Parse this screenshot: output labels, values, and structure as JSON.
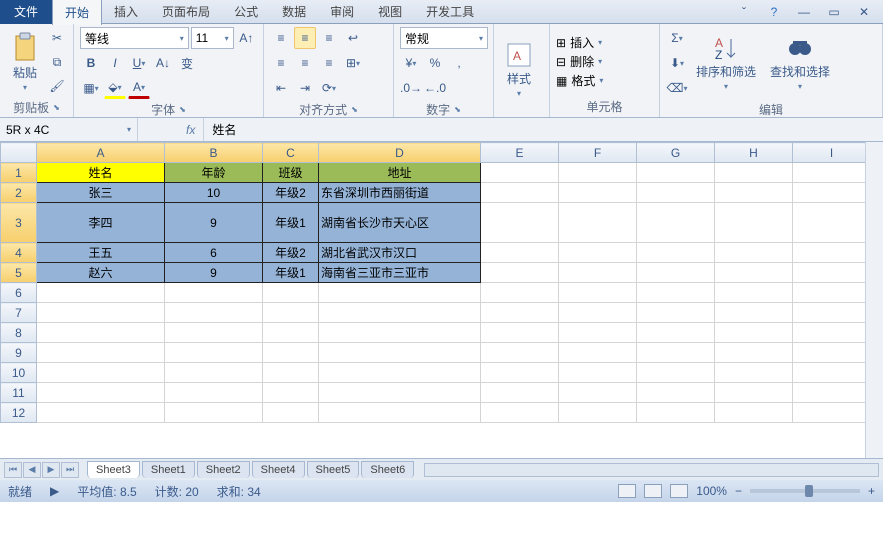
{
  "titlebar": {
    "file": "文件",
    "tabs": [
      "开始",
      "插入",
      "页面布局",
      "公式",
      "数据",
      "审阅",
      "视图",
      "开发工具"
    ],
    "active": 0
  },
  "ribbon": {
    "clipboard": {
      "label": "剪贴板",
      "paste": "粘贴"
    },
    "font": {
      "label": "字体",
      "name": "等线",
      "size": "11"
    },
    "align": {
      "label": "对齐方式"
    },
    "number": {
      "label": "数字",
      "format": "常规"
    },
    "styles": {
      "label": "样式"
    },
    "cells": {
      "label": "单元格",
      "insert": "插入",
      "delete": "删除",
      "format": "格式"
    },
    "editing": {
      "label": "编辑",
      "sort": "排序和筛选",
      "find": "查找和选择"
    }
  },
  "formula": {
    "name": "5R x 4C",
    "value": "姓名"
  },
  "columns": [
    "A",
    "B",
    "C",
    "D",
    "E",
    "F",
    "G",
    "H",
    "I"
  ],
  "rows": [
    1,
    2,
    3,
    4,
    5,
    6,
    7,
    8,
    9,
    10,
    11,
    12
  ],
  "headers": [
    "姓名",
    "年龄",
    "班级",
    "地址"
  ],
  "data": [
    {
      "name": "张三",
      "age": "10",
      "class": "年级2",
      "addr": "东省深圳市西丽街道"
    },
    {
      "name": "李四",
      "age": "9",
      "class": "年级1",
      "addr": "湖南省长沙市天心区"
    },
    {
      "name": "王五",
      "age": "6",
      "class": "年级2",
      "addr": "湖北省武汉市汉口"
    },
    {
      "name": "赵六",
      "age": "9",
      "class": "年级1",
      "addr": "海南省三亚市三亚市"
    }
  ],
  "sheets": [
    "Sheet3",
    "Sheet1",
    "Sheet2",
    "Sheet4",
    "Sheet5",
    "Sheet6"
  ],
  "status": {
    "ready": "就绪",
    "avg_label": "平均值:",
    "avg": "8.5",
    "count_label": "计数:",
    "count": "20",
    "sum_label": "求和:",
    "sum": "34",
    "zoom": "100%"
  }
}
